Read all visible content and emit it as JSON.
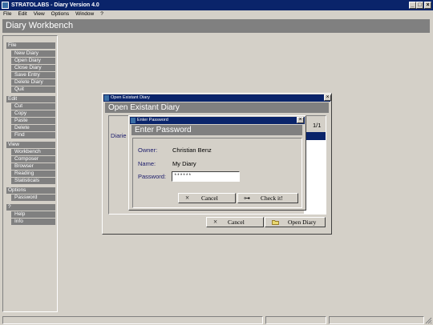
{
  "app": {
    "title": "STRATOLABS - Diary Version 4.0",
    "controls": {
      "minimize": "_",
      "maximize": "□",
      "close": "×"
    }
  },
  "menu": [
    "File",
    "Edit",
    "View",
    "Options",
    "Window",
    "?"
  ],
  "workbench": {
    "title": "Diary Workbench"
  },
  "sidebar": {
    "sections": [
      {
        "label": "File",
        "items": [
          "New Diary",
          "Open Diary",
          "Close Diary",
          "Save Entry",
          "Delete Diary",
          "Quit"
        ]
      },
      {
        "label": "Edit",
        "items": [
          "Cut",
          "Copy",
          "Paste",
          "Delete",
          "Find"
        ]
      },
      {
        "label": "View",
        "items": [
          "Workbench",
          "Composer",
          "Browser",
          "Reading",
          "Statisticals"
        ]
      },
      {
        "label": "Options",
        "items": [
          "Password"
        ]
      },
      {
        "label": "?",
        "items": [
          "Help",
          "Info"
        ]
      }
    ]
  },
  "open_dialog": {
    "window_title": "Open Existant Diary",
    "header": "Open Existant Diary",
    "diaries_label": "Diarie",
    "page_counter": "1/1",
    "cancel_label": "Cancel",
    "open_label": "Open Diary",
    "close_glyph": "×"
  },
  "password_dialog": {
    "window_title": "Enter Password",
    "header": "Enter Password",
    "owner_label": "Owner:",
    "owner_value": "Christian Benz",
    "name_label": "Name:",
    "name_value": "My Diary",
    "password_label": "Password:",
    "password_value": "******",
    "cancel_label": "Cancel",
    "check_label": "Check it!",
    "close_glyph": "×"
  },
  "icons": {
    "cancel": "×",
    "key": "⊶",
    "folder": "folder-icon"
  }
}
